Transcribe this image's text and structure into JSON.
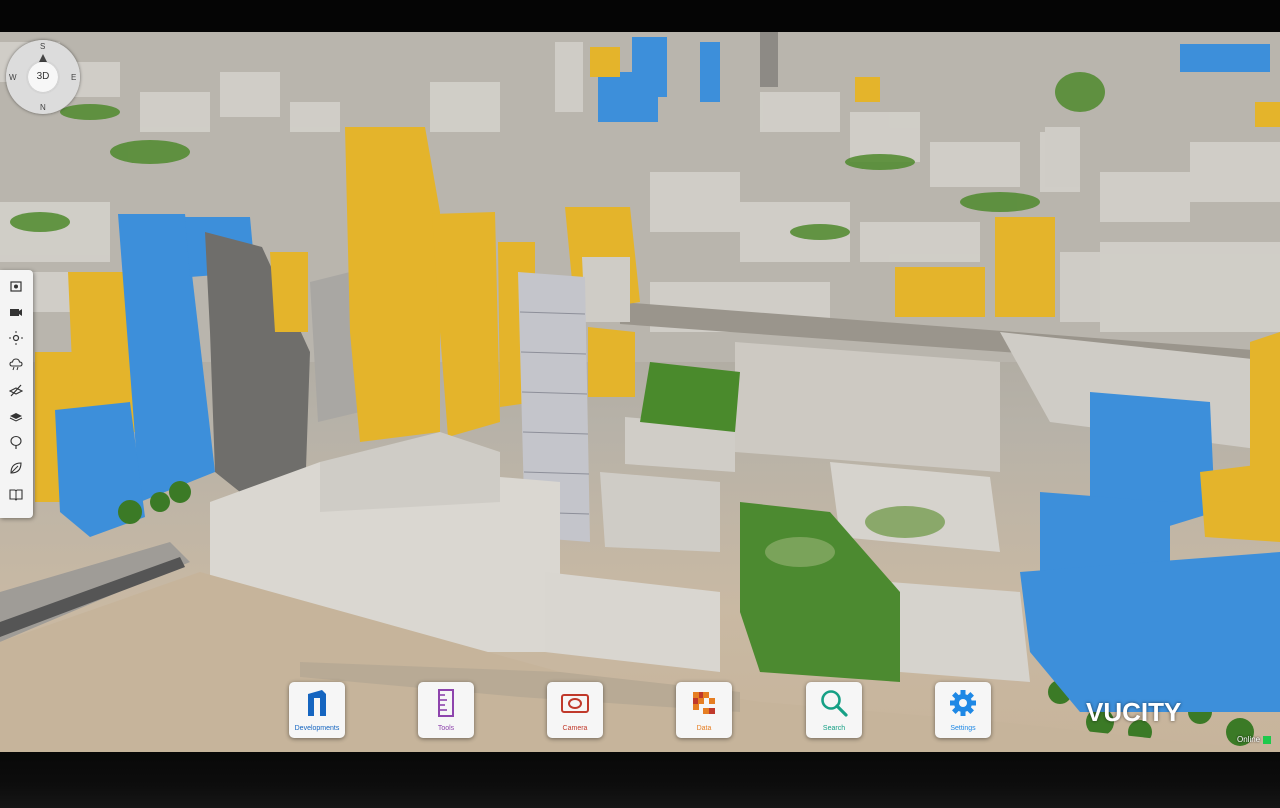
{
  "compass": {
    "view_mode": "3D",
    "directions": [
      "S",
      "E",
      "N",
      "W"
    ]
  },
  "sidebar": {
    "tools": [
      {
        "name": "screenshot-icon"
      },
      {
        "name": "video-icon"
      },
      {
        "name": "sun-icon"
      },
      {
        "name": "weather-icon"
      },
      {
        "name": "hide-layer-icon"
      },
      {
        "name": "layers-icon"
      },
      {
        "name": "tree-icon"
      },
      {
        "name": "leaf-icon"
      },
      {
        "name": "book-icon"
      }
    ]
  },
  "dock": {
    "items": [
      {
        "label": "Developments",
        "icon": "developments-icon",
        "color": "#1565c0"
      },
      {
        "label": "Tools",
        "icon": "ruler-icon",
        "color": "#8e44ad"
      },
      {
        "label": "Camera",
        "icon": "camera-icon",
        "color": "#c0392b"
      },
      {
        "label": "Data",
        "icon": "data-icon",
        "color": "#e67e22"
      },
      {
        "label": "Search",
        "icon": "search-icon",
        "color": "#16a085"
      },
      {
        "label": "Settings",
        "icon": "gear-icon",
        "color": "#1e88e5"
      }
    ]
  },
  "brand": {
    "logo_text": "VUCITY"
  },
  "status": {
    "label": "Online",
    "color": "#1ec94c"
  },
  "colors": {
    "proposed_yellow": "#e6b52a",
    "consented_blue": "#3a8fdc",
    "existing_grey": "#d8d5cf",
    "river": "#c9b79e",
    "trees": "#3f7a2a"
  }
}
